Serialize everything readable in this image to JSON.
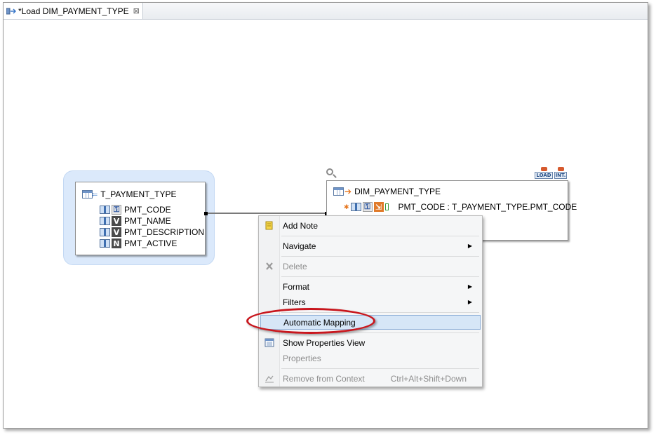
{
  "tab": {
    "title": "*Load DIM_PAYMENT_TYPE",
    "close_glyph": "⊠"
  },
  "source": {
    "name": "T_PAYMENT_TYPE",
    "columns": [
      {
        "badge": "⚿",
        "label": "PMT_CODE"
      },
      {
        "badge": "V",
        "label": "PMT_NAME"
      },
      {
        "badge": "V",
        "label": "PMT_DESCRIPTION"
      },
      {
        "badge": "N",
        "label": "PMT_ACTIVE"
      }
    ]
  },
  "target": {
    "name": "DIM_PAYMENT_TYPE",
    "rows": [
      {
        "label": "PMT_CODE : T_PAYMENT_TYPE.PMT_CODE"
      }
    ],
    "badges": [
      "LOAD",
      "INT."
    ]
  },
  "context_menu": {
    "items": [
      {
        "label": "Add Note",
        "icon": "note-icon",
        "enabled": true
      },
      {
        "label": "Navigate",
        "submenu": true,
        "enabled": true
      },
      {
        "label": "Delete",
        "icon": "delete-icon",
        "enabled": false
      },
      {
        "label": "Format",
        "submenu": true,
        "enabled": true
      },
      {
        "label": "Filters",
        "submenu": true,
        "enabled": true
      },
      {
        "label": "Automatic Mapping",
        "enabled": true,
        "highlighted": true
      },
      {
        "label": "Show Properties View",
        "icon": "properties-view-icon",
        "enabled": true
      },
      {
        "label": "Properties",
        "enabled": false
      },
      {
        "label": "Remove from Context",
        "icon": "remove-context-icon",
        "enabled": false,
        "accelerator": "Ctrl+Alt+Shift+Down"
      }
    ]
  },
  "colors": {
    "highlight_ring": "#c8161d",
    "selection_bg": "#d6e6f7",
    "group_bg": "#dbe9fb"
  }
}
